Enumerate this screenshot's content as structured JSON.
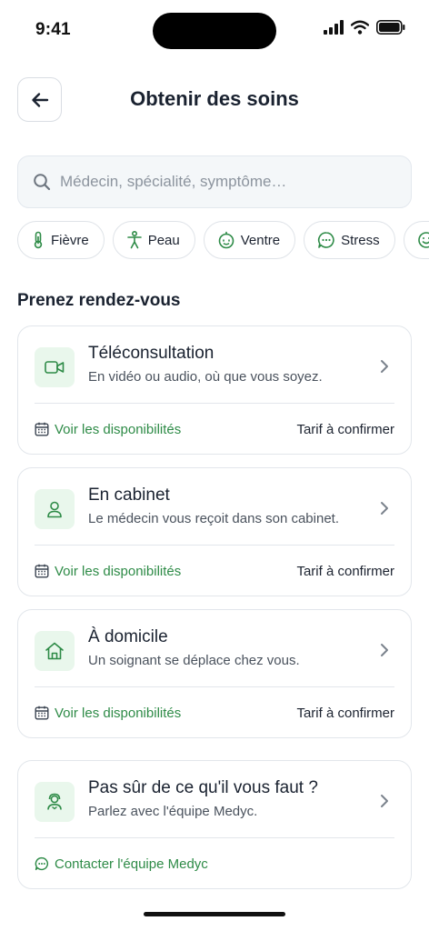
{
  "status": {
    "time": "9:41"
  },
  "header": {
    "title": "Obtenir des soins"
  },
  "search": {
    "placeholder": "Médecin, spécialité, symptôme…"
  },
  "chips": [
    {
      "label": "Fièvre",
      "icon": "thermometer-icon"
    },
    {
      "label": "Peau",
      "icon": "body-icon"
    },
    {
      "label": "Ventre",
      "icon": "stomach-icon"
    },
    {
      "label": "Stress",
      "icon": "chat-icon"
    },
    {
      "label": "",
      "icon": "smiley-icon"
    }
  ],
  "section": {
    "title": "Prenez rendez-vous"
  },
  "cards": [
    {
      "title": "Téléconsultation",
      "subtitle": "En vidéo ou audio, où que vous soyez.",
      "icon": "video-icon",
      "link": "Voir les disponibilités",
      "price": "Tarif à confirmer"
    },
    {
      "title": "En cabinet",
      "subtitle": "Le médecin vous reçoit dans son cabinet.",
      "icon": "person-icon",
      "link": "Voir les disponibilités",
      "price": "Tarif à confirmer"
    },
    {
      "title": "À domicile",
      "subtitle": "Un soignant se déplace chez vous.",
      "icon": "home-icon",
      "link": "Voir les disponibilités",
      "price": "Tarif à confirmer"
    },
    {
      "title": "Pas sûr de ce qu'il vous faut ?",
      "subtitle": "Parlez avec l'équipe Medyc.",
      "icon": "support-icon",
      "link": "Contacter l'équipe Medyc"
    }
  ],
  "colors": {
    "accent": "#2e8b47",
    "icon_bg": "#e9f7ec",
    "border": "#e2e6eb"
  }
}
